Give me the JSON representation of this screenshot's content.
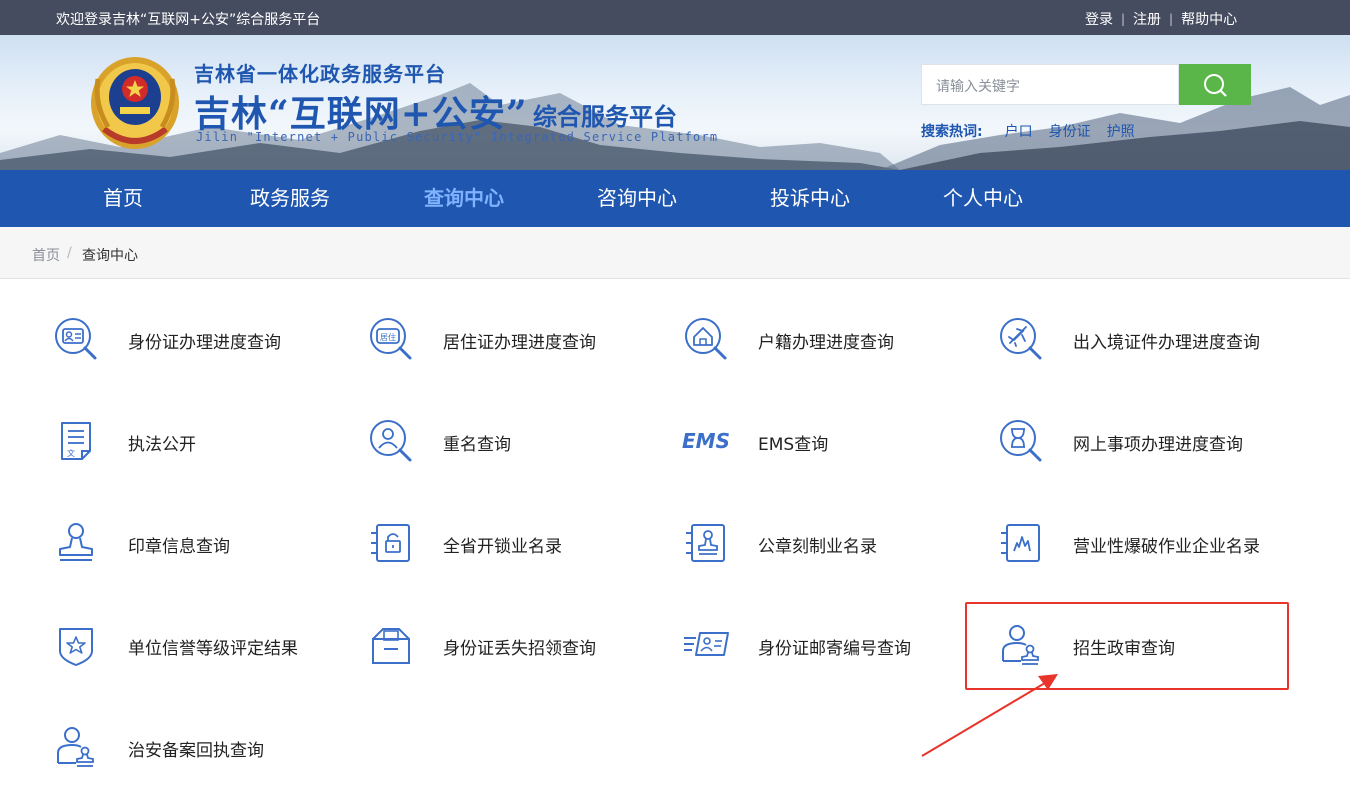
{
  "topbar": {
    "welcome": "欢迎登录吉林“互联网+公安”综合服务平台",
    "login": "登录",
    "register": "注册",
    "help": "帮助中心",
    "separator": "|"
  },
  "brand": {
    "line1": "吉林省一体化政务服务平台",
    "line2_main": "吉林“互联网+公安”",
    "line2_sub": "综合服务平台",
    "line3": "Jilin \"Internet + Public Security\" Integrated Service Platform"
  },
  "search": {
    "placeholder": "请输入关键字",
    "hot_label": "搜索热词:",
    "hot_words": [
      "户口",
      "身份证",
      "护照"
    ]
  },
  "nav": {
    "items": [
      "首页",
      "政务服务",
      "查询中心",
      "咨询中心",
      "投诉中心",
      "个人中心"
    ],
    "active": "查询中心"
  },
  "breadcrumb": {
    "home": "首页",
    "separator": "/",
    "current": "查询中心"
  },
  "services": [
    {
      "label": "身份证办理进度查询",
      "icon": "id-card-search-icon"
    },
    {
      "label": "居住证办理进度查询",
      "icon": "residence-permit-search-icon"
    },
    {
      "label": "户籍办理进度查询",
      "icon": "household-search-icon"
    },
    {
      "label": "出入境证件办理进度查询",
      "icon": "airplane-search-icon"
    },
    {
      "label": "执法公开",
      "icon": "document-icon"
    },
    {
      "label": "重名查询",
      "icon": "person-search-icon"
    },
    {
      "label": "EMS查询",
      "icon": "ems-icon",
      "icon_text": "EMS"
    },
    {
      "label": "网上事项办理进度查询",
      "icon": "hourglass-search-icon"
    },
    {
      "label": "印章信息查询",
      "icon": "seal-icon"
    },
    {
      "label": "全省开锁业名录",
      "icon": "lock-list-icon"
    },
    {
      "label": "公章刻制业名录",
      "icon": "stamp-list-icon"
    },
    {
      "label": "营业性爆破作业企业名录",
      "icon": "explosion-list-icon"
    },
    {
      "label": "单位信誉等级评定结果",
      "icon": "star-shield-icon"
    },
    {
      "label": "身份证丢失招领查询",
      "icon": "lost-found-box-icon"
    },
    {
      "label": "身份证邮寄编号查询",
      "icon": "id-card-mail-icon"
    },
    {
      "label": "招生政审查询",
      "icon": "admission-review-icon"
    },
    {
      "label": "治安备案回执查询",
      "icon": "security-filing-icon"
    }
  ],
  "colors": {
    "nav_bg": "#1f56b0",
    "topbar_bg": "#454c5f",
    "search_button": "#5ab649",
    "icon_blue": "#3b6fc9",
    "highlight_red": "#e8342a"
  }
}
